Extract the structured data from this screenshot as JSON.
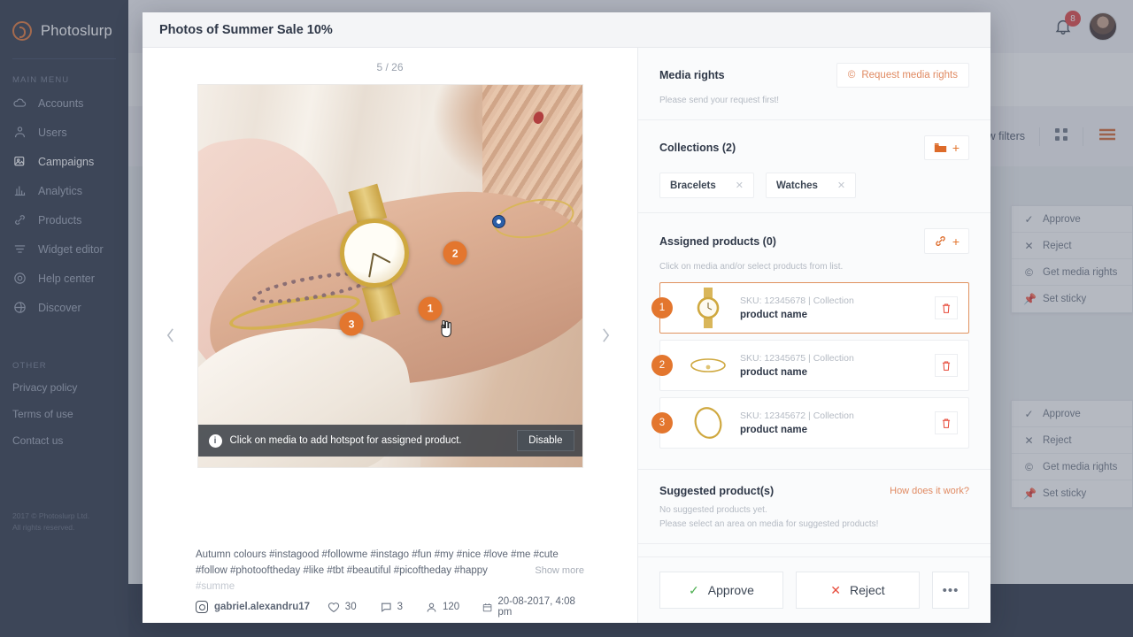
{
  "brand": {
    "name": "Photoslurp"
  },
  "sidebar": {
    "main_label": "MAIN MENU",
    "items": [
      {
        "label": "Accounts",
        "icon": "cloud-icon"
      },
      {
        "label": "Users",
        "icon": "users-icon"
      },
      {
        "label": "Campaigns",
        "icon": "campaigns-icon"
      },
      {
        "label": "Analytics",
        "icon": "chart-icon"
      },
      {
        "label": "Products",
        "icon": "link-icon"
      },
      {
        "label": "Widget editor",
        "icon": "sliders-icon"
      },
      {
        "label": "Help center",
        "icon": "help-icon"
      },
      {
        "label": "Discover",
        "icon": "globe-icon"
      }
    ],
    "other_label": "OTHER",
    "other": [
      {
        "label": "Privacy policy"
      },
      {
        "label": "Terms of use"
      },
      {
        "label": "Contact us"
      }
    ],
    "copyright_line1": "2017 © Photoslurp Ltd.",
    "copyright_line2": "All rights reserved."
  },
  "topbar": {
    "notification_count": "8",
    "bell_icon": "bell-icon",
    "avatar_icon": "avatar"
  },
  "filterbar": {
    "show_filters": "Show filters",
    "grid_icon": "grid-view-icon",
    "list_icon": "list-view-icon"
  },
  "context_menu": {
    "items": [
      {
        "label": "Approve",
        "icon": "check-icon"
      },
      {
        "label": "Reject",
        "icon": "close-icon"
      },
      {
        "label": "Get media rights",
        "icon": "copyright-icon"
      },
      {
        "label": "Set sticky",
        "icon": "pin-icon"
      }
    ]
  },
  "modal": {
    "title": "Photos of Summer Sale 10%",
    "close_icon": "close-icon"
  },
  "viewer": {
    "counter": "5 / 26",
    "prev_icon": "chevron-left-icon",
    "next_icon": "chevron-right-icon",
    "notice": "Click on media to add hotspot for assigned product.",
    "notice_icon": "info-icon",
    "disable_label": "Disable",
    "hotspots": [
      {
        "label": "1"
      },
      {
        "label": "2"
      },
      {
        "label": "3"
      }
    ],
    "caption_line1": "Autumn colours #instagood #followme #instago #fun #my #nice #love #me #cute",
    "caption_line2": "#follow #photooftheday #like #tbt #beautiful #picoftheday #happy ",
    "caption_faded": "#summe",
    "show_more": "Show more",
    "handle": "gabriel.alexandru17",
    "handle_icon": "instagram-icon",
    "likes": "30",
    "likes_icon": "heart-icon",
    "comments": "3",
    "comments_icon": "comment-icon",
    "reach": "120",
    "reach_icon": "person-icon",
    "date": "20-08-2017, 4:08 pm",
    "date_icon": "calendar-icon"
  },
  "panel": {
    "media_rights": {
      "title": "Media rights",
      "button_label": "Request media rights",
      "button_icon": "copyright-icon",
      "note": "Please send your request first!"
    },
    "collections": {
      "title": "Collections (2)",
      "add_icon": "folder-icon",
      "add_plus": "+",
      "tags": [
        {
          "label": "Bracelets",
          "remove_icon": "close-icon"
        },
        {
          "label": "Watches",
          "remove_icon": "close-icon"
        }
      ]
    },
    "assigned": {
      "title": "Assigned products (0)",
      "add_icon": "link-icon",
      "add_plus": "+",
      "hint": "Click on media and/or select products from list.",
      "products": [
        {
          "num": "1",
          "sku": "SKU: 12345678  |  Collection",
          "name": "product name",
          "thumb": "watch-thumb",
          "delete_icon": "trash-icon",
          "selected": true
        },
        {
          "num": "2",
          "sku": "SKU: 12345675  |  Collection",
          "name": "product name",
          "thumb": "bracelet-thumb",
          "delete_icon": "trash-icon",
          "selected": false
        },
        {
          "num": "3",
          "sku": "SKU: 12345672  |  Collection",
          "name": "product name",
          "thumb": "bangle-thumb",
          "delete_icon": "trash-icon",
          "selected": false
        }
      ]
    },
    "suggested": {
      "title": "Suggested product(s)",
      "how_link": "How does it work?",
      "empty_line1": "No suggested products yet.",
      "empty_line2": "Please select an area on media for suggested products!"
    },
    "footer": {
      "approve_label": "Approve",
      "approve_icon": "check-icon",
      "reject_label": "Reject",
      "reject_icon": "close-icon",
      "more_label": "•••"
    }
  },
  "colors": {
    "accent": "#e3762e",
    "accent_soft": "#e08a62",
    "sidebar_bg": "#252e41",
    "approve_green": "#4caf50",
    "reject_red": "#e74c3c",
    "badge_red": "#e03c3c"
  }
}
